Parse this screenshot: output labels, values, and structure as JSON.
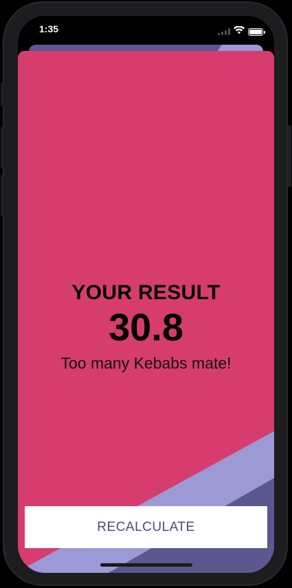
{
  "status_bar": {
    "time": "1:35"
  },
  "result": {
    "title": "YOUR RESULT",
    "value": "30.8",
    "message": "Too many Kebabs mate!"
  },
  "actions": {
    "recalculate_label": "RECALCULATE"
  },
  "colors": {
    "card_background": "#d63d6e",
    "accent_light": "#9b99d6",
    "accent_dark": "#5a588e",
    "button_text": "#4a4a7c"
  },
  "icons": {
    "signal": "signal-icon",
    "wifi": "wifi-icon",
    "battery": "battery-icon"
  }
}
